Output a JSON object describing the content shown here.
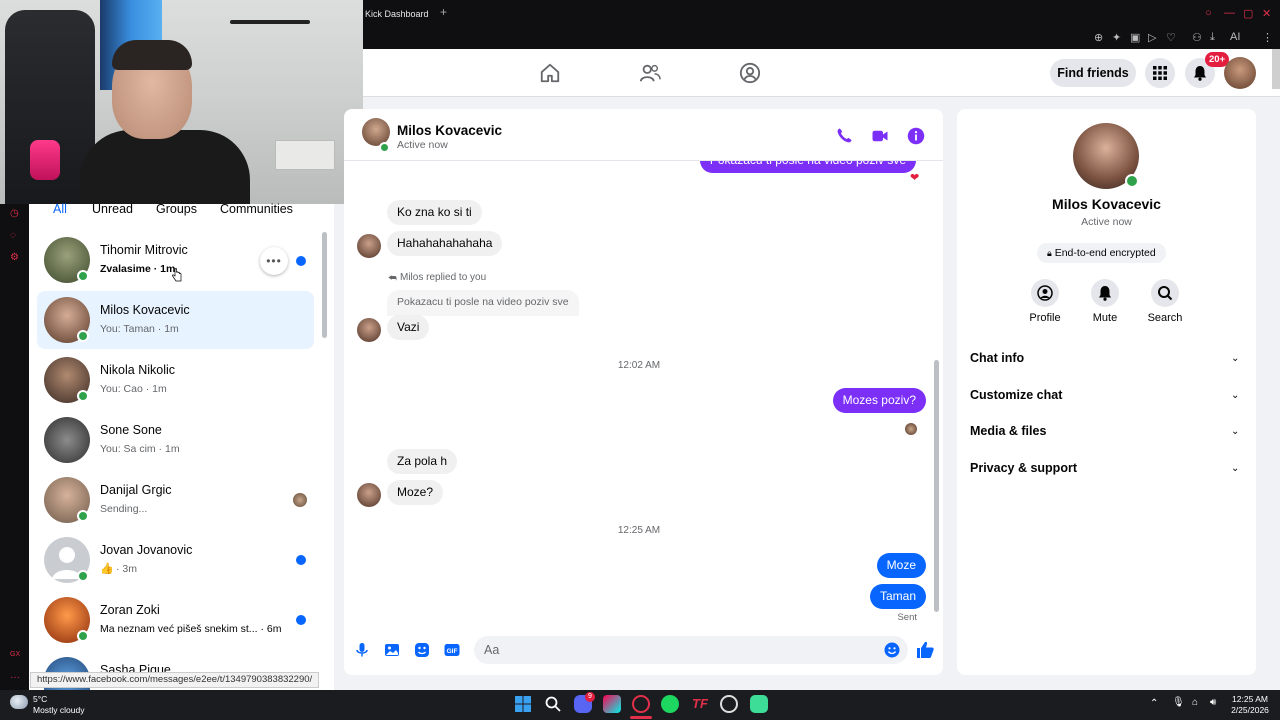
{
  "browser": {
    "tab_title": "Kick Dashboard",
    "tab_plus": "+"
  },
  "icons": {
    "home": "home-icon",
    "friends": "friends-icon",
    "groups": "groups-icon",
    "menu": "grid-menu-icon",
    "bell": "bell-icon",
    "phone": "phone-icon",
    "video": "video-camera-icon",
    "info": "info-icon"
  },
  "colors": {
    "accent_purple": "#7b2ff7",
    "accent_blue": "#0866ff",
    "online_green": "#31a24c",
    "badge_red": "#e41e3f"
  },
  "header": {
    "find_friends": "Find friends",
    "notif_badge": "20+"
  },
  "chat_list": {
    "filters": [
      "All",
      "Unread",
      "Groups",
      "Communities"
    ],
    "items": [
      {
        "name": "Tihomir Mitrovic",
        "preview": "Zvalasime · 1m",
        "unread": true,
        "bold": true
      },
      {
        "name": "Milos Kovacevic",
        "preview": "You: Taman · 1m",
        "unread": false,
        "bold": false
      },
      {
        "name": "Nikola Nikolic",
        "preview": "You: Cao · 1m",
        "unread": false,
        "bold": false
      },
      {
        "name": "Sone Sone",
        "preview": "You: Sa cim · 1m",
        "unread": false,
        "bold": false
      },
      {
        "name": "Danijal Grgic",
        "preview": "Sending...",
        "unread": false,
        "bold": false
      },
      {
        "name": "Jovan Jovanovic",
        "preview": "· 3m",
        "unread": true,
        "bold": false
      },
      {
        "name": "Zoran Zoki",
        "preview": "Ma neznam već pišeš snekim st... · 6m",
        "unread": true,
        "bold": true
      },
      {
        "name": "Sasha Pique",
        "preview": "",
        "unread": false,
        "bold": false
      }
    ],
    "more_options": "•••"
  },
  "status_url": "https://www.facebook.com/messages/e2ee/t/1349790383832290/",
  "conversation": {
    "name": "Milos Kovacevic",
    "status": "Active now",
    "messages": {
      "top_cut": "Pokazacu ti posle na video poziv sve",
      "m1": "Ko zna ko si ti",
      "m2": "Hahahahahahaha",
      "reply_note": "Milos replied to you",
      "reply_quote": "Pokazacu ti posle na video poziv sve",
      "m3": "Vazi",
      "time1": "12:02 AM",
      "m4": "Mozes poziv?",
      "m5": "Za pola h",
      "m6": "Moze?",
      "time2": "12:25 AM",
      "m7": "Moze",
      "m8": "Taman",
      "sent": "Sent"
    },
    "composer_placeholder": "Aa"
  },
  "right_panel": {
    "name": "Milos Kovacevic",
    "status": "Active now",
    "e2e": "End-to-end encrypted",
    "buttons": [
      "Profile",
      "Mute",
      "Search"
    ],
    "sections": [
      "Chat info",
      "Customize chat",
      "Media & files",
      "Privacy & support"
    ]
  },
  "taskbar": {
    "weather_temp": "5°C",
    "weather_desc": "Mostly cloudy",
    "time": "12:25 AM",
    "date": "2/25/2026",
    "discord_badge": "9"
  }
}
